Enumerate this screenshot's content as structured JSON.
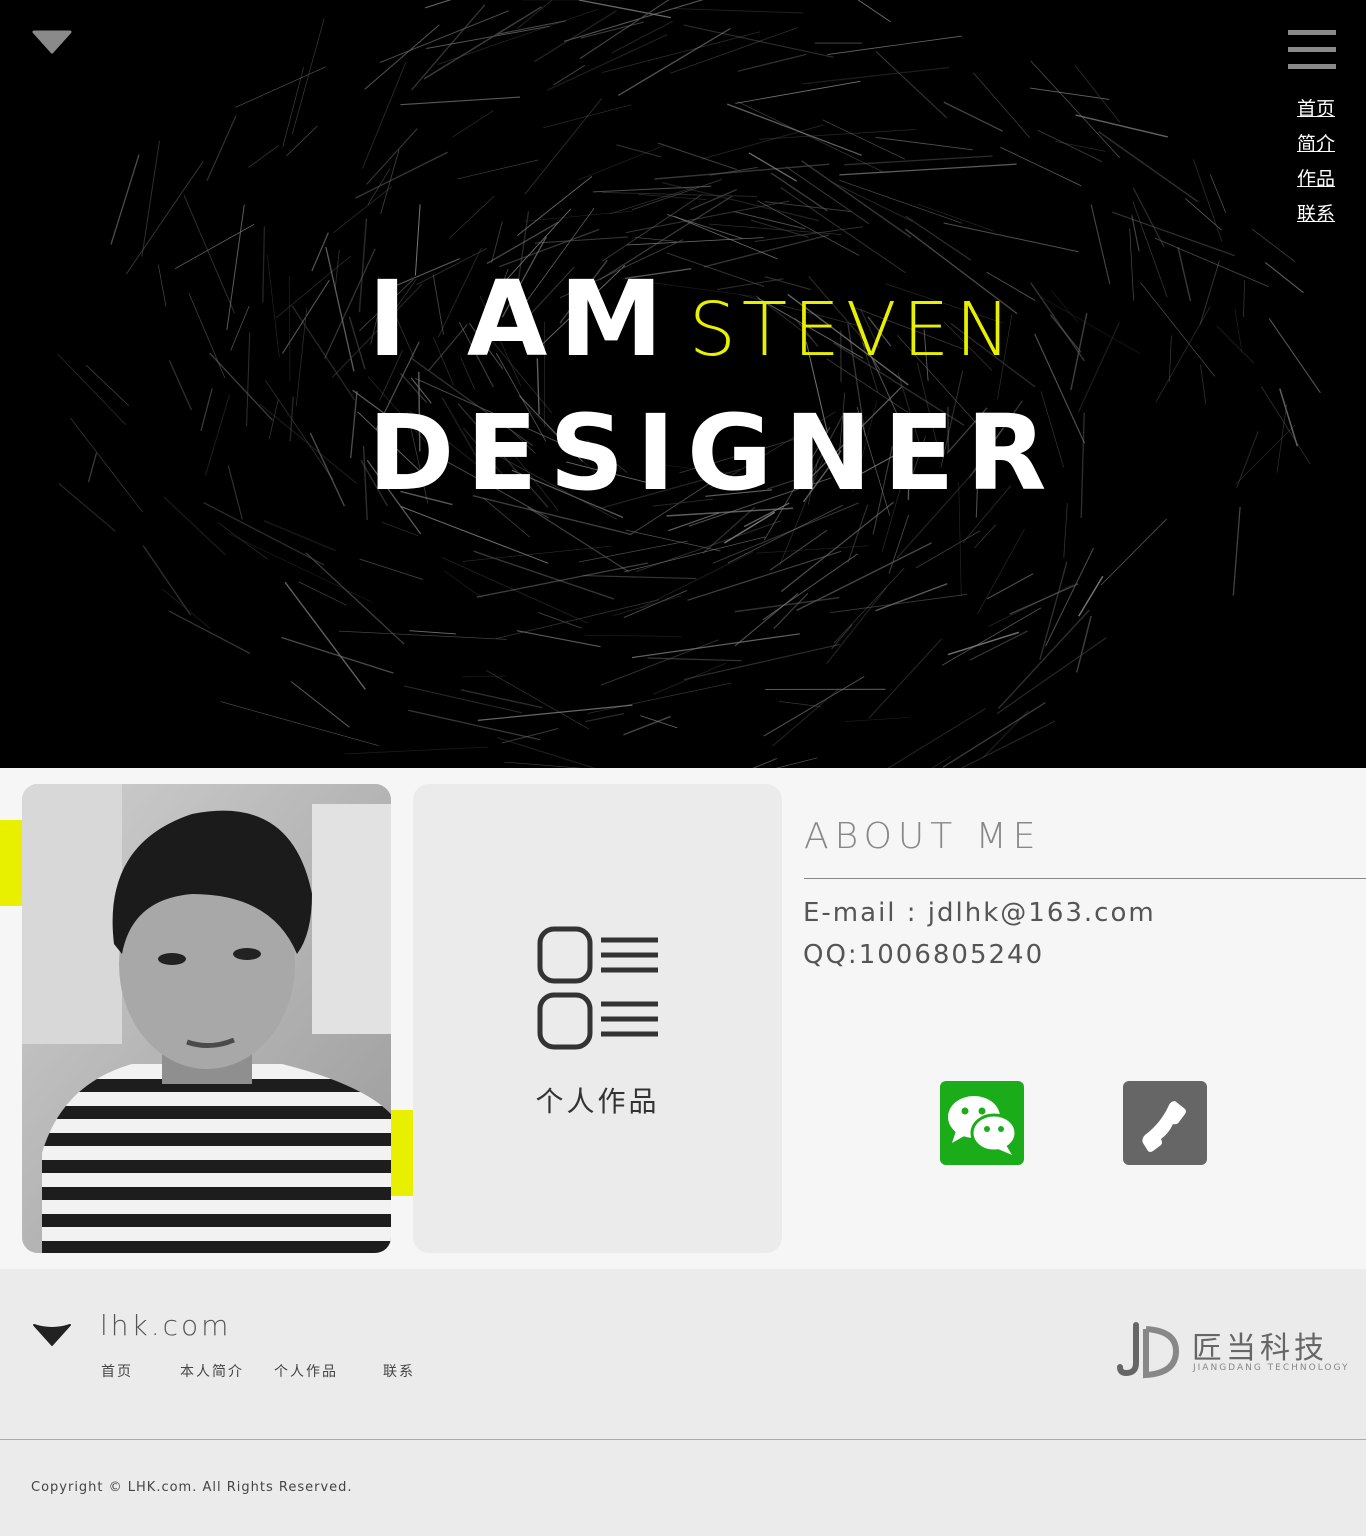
{
  "hero": {
    "line1_prefix": "I AM",
    "name": "STEVEN",
    "line2": "DESIGNER",
    "accent_color": "#e8f000"
  },
  "nav": {
    "menu_icon": "hamburger-icon",
    "items": [
      {
        "label": "首页"
      },
      {
        "label": "简介"
      },
      {
        "label": "作品"
      },
      {
        "label": "联系"
      }
    ]
  },
  "works": {
    "label": "个人作品",
    "icon": "list-icon"
  },
  "about": {
    "title": "ABOUT ME",
    "email_line": "E-mail : jdlhk@163.com",
    "qq_line": "QQ:1006805240",
    "wechat_icon": "wechat-icon",
    "wechat_color": "#1aad19",
    "phone_icon": "phone-icon"
  },
  "footer": {
    "domain": "lhk.com",
    "nav": [
      {
        "label": "首页"
      },
      {
        "label": "本人简介"
      },
      {
        "label": "个人作品"
      },
      {
        "label": "联系"
      }
    ],
    "brand_name": "匠当科技",
    "brand_sub": "JIANGDANG TECHNOLOGY",
    "copyright": "Copyright © LHK.com. All Rights Reserved."
  }
}
